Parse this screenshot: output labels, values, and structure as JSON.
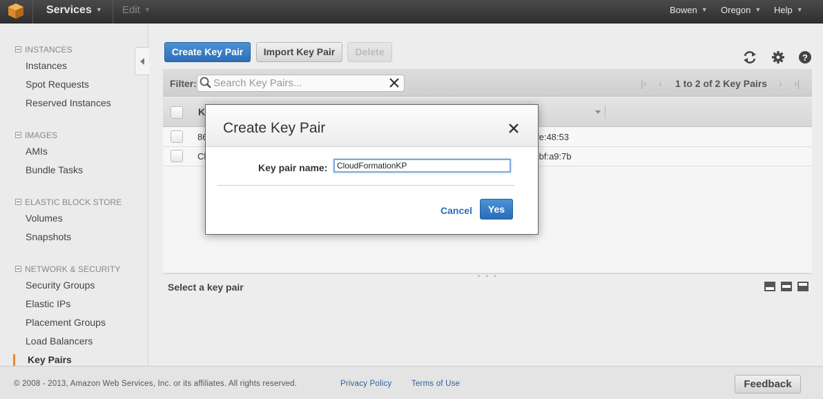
{
  "topnav": {
    "services_label": "Services",
    "edit_label": "Edit",
    "user_label": "Bowen",
    "region_label": "Oregon",
    "help_label": "Help"
  },
  "sidebar": {
    "sections": [
      {
        "title": "INSTANCES",
        "items": [
          "Instances",
          "Spot Requests",
          "Reserved Instances"
        ]
      },
      {
        "title": "IMAGES",
        "items": [
          "AMIs",
          "Bundle Tasks"
        ]
      },
      {
        "title": "ELASTIC BLOCK STORE",
        "items": [
          "Volumes",
          "Snapshots"
        ]
      },
      {
        "title": "NETWORK & SECURITY",
        "items": [
          "Security Groups",
          "Elastic IPs",
          "Placement Groups",
          "Load Balancers",
          "Key Pairs"
        ]
      }
    ],
    "active_item": "Key Pairs"
  },
  "toolbar": {
    "create_label": "Create Key Pair",
    "import_label": "Import Key Pair",
    "delete_label": "Delete"
  },
  "filter": {
    "label": "Filter:",
    "placeholder": "Search Key Pairs..."
  },
  "pager": {
    "text": "1 to 2 of 2 Key Pairs"
  },
  "table": {
    "header_visible": "K",
    "rows": [
      {
        "name_visible": "86",
        "fingerprint_visible": "fe:48:53"
      },
      {
        "name_visible": "Cl",
        "fingerprint_visible": ":bf:a9:7b"
      }
    ]
  },
  "detail": {
    "title": "Select a key pair"
  },
  "modal": {
    "title": "Create Key Pair",
    "field_label": "Key pair name:",
    "field_value": "CloudFormationKP",
    "cancel_label": "Cancel",
    "yes_label": "Yes"
  },
  "footer": {
    "copyright": "© 2008 - 2013, Amazon Web Services, Inc. or its affiliates. All rights reserved.",
    "privacy_label": "Privacy Policy",
    "terms_label": "Terms of Use",
    "feedback_label": "Feedback"
  },
  "colors": {
    "primary_blue": "#2b6fb9",
    "active_accent": "#e6892e",
    "link_blue": "#2a6fb8"
  }
}
